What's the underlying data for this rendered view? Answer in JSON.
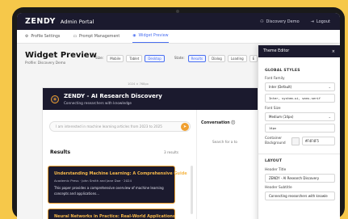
{
  "app": {
    "logo": "ZENDY",
    "portal_title": "Admin Portal",
    "user_label": "Discovery Demo",
    "logout_label": "Logout"
  },
  "tabs": [
    {
      "label": "Profile Settings",
      "icon": "gear-icon",
      "active": false
    },
    {
      "label": "Prompt Management",
      "icon": "chat-icon",
      "active": false
    },
    {
      "label": "Widget Preview",
      "icon": "eye-icon",
      "active": true
    }
  ],
  "preview": {
    "title": "Widget Preview",
    "subtitle": "Profile: Discovery Demo",
    "size_label": "Size:",
    "sizes": [
      "Mobile",
      "Tablet",
      "Desktop"
    ],
    "selected_size": "Desktop",
    "state_label": "State:",
    "states": [
      "Results",
      "Dialog",
      "Loading",
      "E"
    ],
    "selected_state": "Results",
    "dimension": "1024 × 768px"
  },
  "widget": {
    "title": "ZENDY - AI Research Discovery",
    "subtitle": "Connecting researchers with knowledge",
    "search_placeholder": "I am interested in machine learning articles from 2023 to 2025",
    "conversation_label": "Conversation",
    "conversation_placeholder": "Search for a to",
    "results_label": "Results",
    "results_count": "3 results",
    "cards": [
      {
        "title": "Understanding Machine Learning: A Comprehensive Guide",
        "meta": "Academic Press · John Smith and Jane Doe · 2024",
        "description": "This paper provides a comprehensive overview of machine learning concepts and applications..."
      },
      {
        "title": "Neural Networks in Practice: Real-World Applications",
        "meta": "",
        "description": ""
      }
    ]
  },
  "theme_editor": {
    "title": "Theme Editor",
    "close_icon": "close-icon",
    "global_styles_label": "GLOBAL STYLES",
    "font_family_label": "Font Family",
    "font_family_value": "Inter (Default)",
    "font_family_css": "Inter, system-ui, sans-serif",
    "font_size_label": "Font Size",
    "font_size_value": "Medium (14px)",
    "font_size_css": "14px",
    "container_bg_label": "Container Background",
    "container_bg_value": "#F4F4F5",
    "layout_label": "LAYOUT",
    "header_title_label": "Header Title",
    "header_title_value": "ZENDY - AI Research Discovery",
    "header_subtitle_label": "Header Subtitle",
    "header_subtitle_value": "Connecting researchers with knowle"
  },
  "colors": {
    "brand_dark": "#1b1a2e",
    "accent": "#f0a030",
    "link_blue": "#4a6ff0",
    "container_bg": "#F4F4F5"
  }
}
